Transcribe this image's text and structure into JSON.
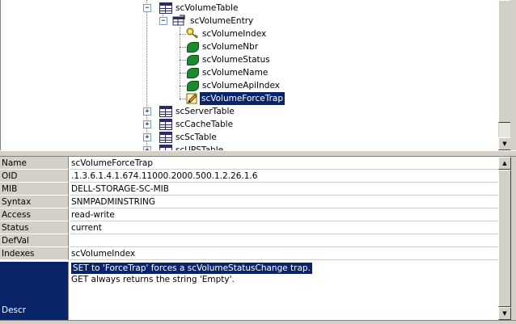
{
  "tree": {
    "nodes": [
      {
        "label": "scVolumeTable"
      },
      {
        "label": "scVolumeEntry"
      },
      {
        "label": "scVolumeIndex"
      },
      {
        "label": "scVolumeNbr"
      },
      {
        "label": "scVolumeStatus"
      },
      {
        "label": "scVolumeName"
      },
      {
        "label": "scVolumeApiIndex"
      },
      {
        "label": "scVolumeForceTrap"
      },
      {
        "label": "scServerTable"
      },
      {
        "label": "scCacheTable"
      },
      {
        "label": "scScTable"
      },
      {
        "label": "scUPSTable"
      }
    ],
    "expand_glyph": "+",
    "collapse_glyph": "−"
  },
  "properties": {
    "rows": [
      {
        "key": "Name",
        "value": "scVolumeForceTrap"
      },
      {
        "key": "OID",
        "value": ".1.3.6.1.4.1.674.11000.2000.500.1.2.26.1.6"
      },
      {
        "key": "MIB",
        "value": "DELL-STORAGE-SC-MIB"
      },
      {
        "key": "Syntax",
        "value": "SNMPADMINSTRING"
      },
      {
        "key": "Access",
        "value": "read-write"
      },
      {
        "key": "Status",
        "value": "current"
      },
      {
        "key": "DefVal",
        "value": ""
      },
      {
        "key": "Indexes",
        "value": "scVolumeIndex"
      }
    ],
    "descr": {
      "key": "Descr",
      "lines": [
        "SET to 'ForceTrap' forces a scVolumeStatusChange trap.",
        "GET always returns the string 'Empty'."
      ]
    }
  },
  "scroll": {
    "up": "▲",
    "down": "▼"
  },
  "colors": {
    "selection": "#0a246a",
    "leaf": "#1d8a2d",
    "chrome": "#d4d0c8"
  }
}
